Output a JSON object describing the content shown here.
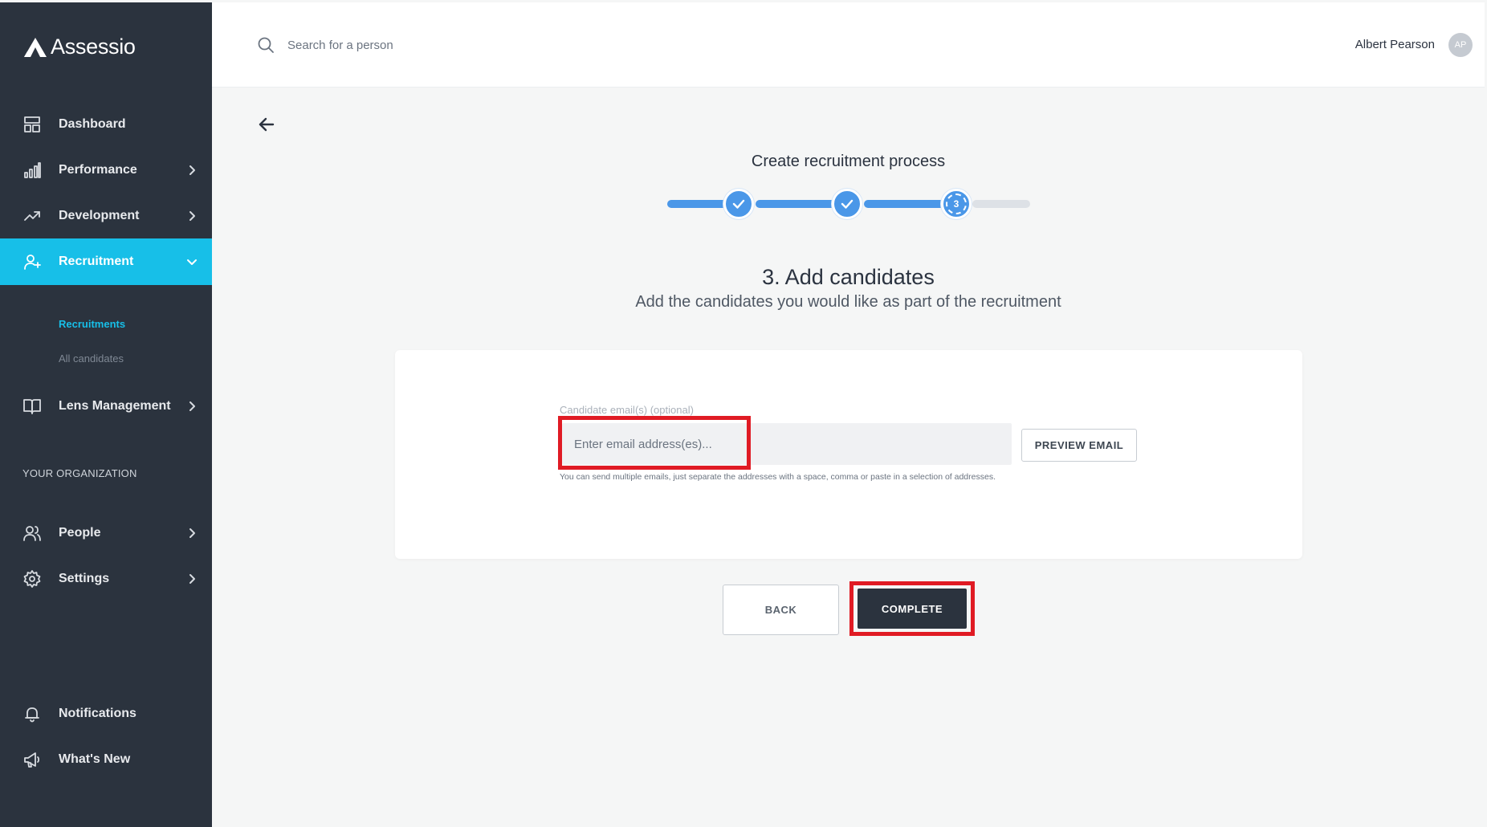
{
  "app": {
    "logo_text": "Assessio"
  },
  "sidebar": {
    "items": [
      {
        "label": "Dashboard",
        "icon": "dashboard-icon"
      },
      {
        "label": "Performance",
        "icon": "bar-chart-icon"
      },
      {
        "label": "Development",
        "icon": "trending-up-icon"
      },
      {
        "label": "Recruitment",
        "icon": "user-plus-icon"
      },
      {
        "label": "Lens Management",
        "icon": "book-icon"
      },
      {
        "label": "People",
        "icon": "people-icon"
      },
      {
        "label": "Settings",
        "icon": "gear-icon"
      },
      {
        "label": "Notifications",
        "icon": "bell-icon"
      },
      {
        "label": "What's New",
        "icon": "megaphone-icon"
      }
    ],
    "sub_items": [
      {
        "label": "Recruitments"
      },
      {
        "label": "All candidates"
      }
    ],
    "section_label": "YOUR ORGANIZATION",
    "active_color": "#17bfe8",
    "background_color": "#2b333e"
  },
  "topbar": {
    "search_placeholder": "Search for a person",
    "user_name": "Albert Pearson",
    "avatar_initials": "AP"
  },
  "main": {
    "process_title": "Create recruitment process",
    "stepper": {
      "current_step": "3",
      "total_steps": 3
    },
    "step_title": "3. Add candidates",
    "step_subtitle": "Add the candidates you would like as part of the recruitment",
    "form": {
      "email_label": "Candidate email(s) (optional)",
      "email_placeholder": "Enter email address(es)...",
      "email_value": "",
      "preview_button": "PREVIEW EMAIL",
      "help_text": "You can send multiple emails, just separate the addresses with a space, comma or paste in a selection of addresses."
    },
    "back_button": "BACK",
    "complete_button": "COMPLETE",
    "highlight_color": "#e01b24"
  }
}
